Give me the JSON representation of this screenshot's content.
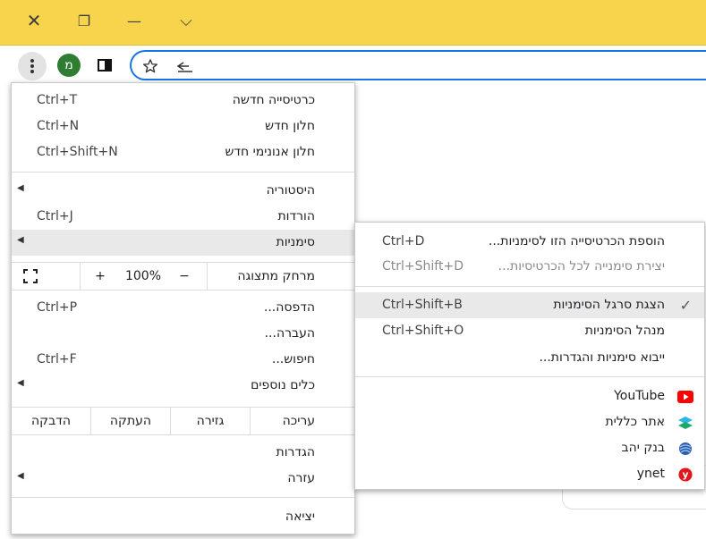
{
  "window": {
    "close_glyph": "✕",
    "restore_glyph": "❐",
    "minimize_glyph": "—",
    "dropdown_glyph": "⌵"
  },
  "toolbar": {
    "avatar_letter": "מ"
  },
  "menu": {
    "new_tab": {
      "label": "כרטיסייה חדשה",
      "shortcut": "Ctrl+T"
    },
    "new_window": {
      "label": "חלון חדש",
      "shortcut": "Ctrl+N"
    },
    "incognito": {
      "label": "חלון אנונימי חדש",
      "shortcut": "Ctrl+Shift+N"
    },
    "history": {
      "label": "היסטוריה"
    },
    "downloads": {
      "label": "הורדות",
      "shortcut": "Ctrl+J"
    },
    "bookmarks": {
      "label": "סימניות"
    },
    "zoom": {
      "label": "מרחק מתצוגה",
      "minus": "−",
      "value": "100%",
      "plus": "+"
    },
    "print": {
      "label": "הדפסה...",
      "shortcut": "Ctrl+P"
    },
    "cast": {
      "label": "העברה..."
    },
    "find": {
      "label": "חיפוש...",
      "shortcut": "Ctrl+F"
    },
    "more_tools": {
      "label": "כלים נוספים"
    },
    "edit": {
      "label": "עריכה",
      "cut": "גזירה",
      "copy": "העתקה",
      "paste": "הדבקה"
    },
    "settings": {
      "label": "הגדרות"
    },
    "help": {
      "label": "עזרה"
    },
    "exit": {
      "label": "יציאה"
    }
  },
  "submenu": {
    "bookmark_tab": {
      "label": "הוספת הכרטיסייה הזו לסימניות...",
      "shortcut": "Ctrl+D"
    },
    "bookmark_all": {
      "label": "יצירת סימנייה לכל הכרטיסיות...",
      "shortcut": "Ctrl+Shift+D"
    },
    "show_bar": {
      "label": "הצגת סרגל הסימניות",
      "shortcut": "Ctrl+Shift+B",
      "checked": true
    },
    "manager": {
      "label": "מנהל הסימניות",
      "shortcut": "Ctrl+Shift+O"
    },
    "import": {
      "label": "ייבוא סימניות והגדרות..."
    },
    "bookmarks": [
      {
        "label": "YouTube",
        "icon": "youtube-icon",
        "color": "#ff0000"
      },
      {
        "label": "אתר כללית",
        "icon": "clalit-icon",
        "color": "#2db5e8"
      },
      {
        "label": "בנק יהב",
        "icon": "bank-yahav-icon",
        "color": "#2d5fa8"
      },
      {
        "label": "ynet",
        "icon": "ynet-icon",
        "color": "#e0161d"
      }
    ]
  }
}
